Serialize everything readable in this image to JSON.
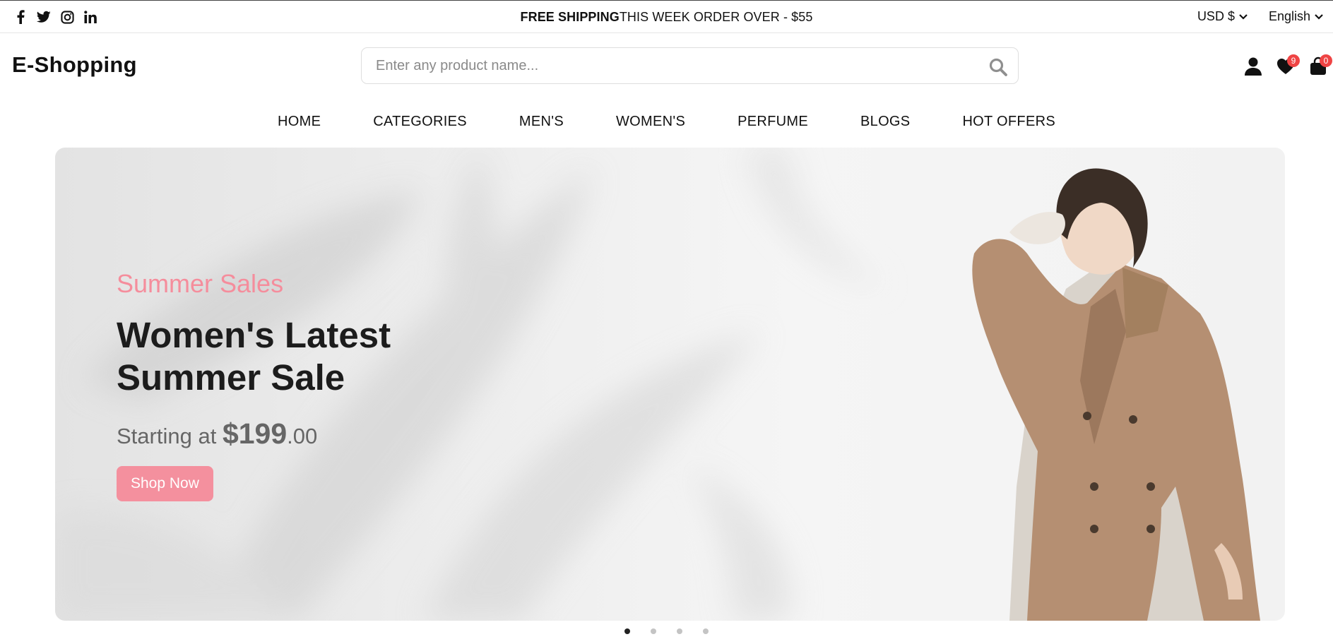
{
  "topbar": {
    "socials": [
      {
        "icon": "facebook-icon"
      },
      {
        "icon": "twitter-icon"
      },
      {
        "icon": "instagram-icon"
      },
      {
        "icon": "linkedin-icon"
      }
    ],
    "shipping_bold": "FREE SHIPPING",
    "shipping_rest": "THIS WEEK ORDER OVER - $55",
    "currency": "USD $",
    "language": "English"
  },
  "header": {
    "logo": "E-Shopping",
    "search_placeholder": "Enter any product name...",
    "wishlist_count": "9",
    "cart_count": "0"
  },
  "nav": {
    "items": [
      "HOME",
      "CATEGORIES",
      "MEN'S",
      "WOMEN'S",
      "PERFUME",
      "BLOGS",
      "HOT OFFERS"
    ]
  },
  "hero": {
    "subtitle": "Summer Sales",
    "title": "Women's Latest Summer Sale",
    "price_prefix": "Starting at",
    "price_main": "$199",
    "price_cents": ".00",
    "button": "Shop Now"
  },
  "carousel": {
    "slide_count": 4,
    "active_index": 0
  },
  "colors": {
    "accent": "#f4909e",
    "subtitle": "#f58d9c",
    "badge": "#ef4444"
  }
}
